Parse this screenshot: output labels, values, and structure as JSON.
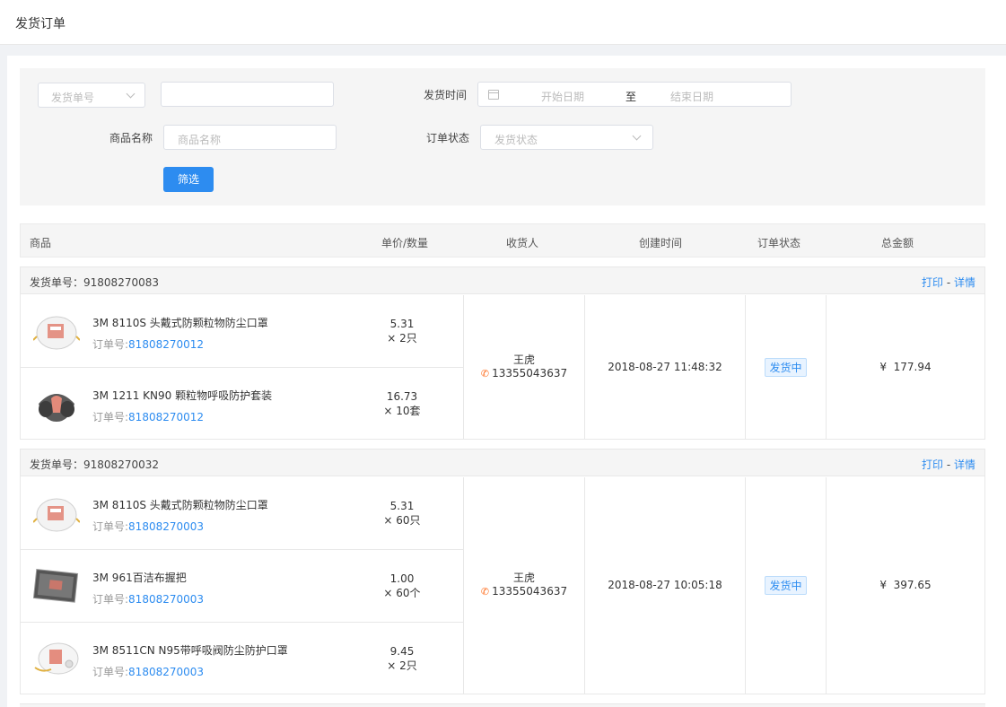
{
  "page": {
    "title": "发货订单"
  },
  "filter": {
    "field_select_placeholder": "发货单号",
    "keyword_value": "",
    "time_label": "发货时间",
    "date_start_placeholder": "开始日期",
    "date_separator": "至",
    "date_end_placeholder": "结束日期",
    "product_label": "商品名称",
    "product_placeholder": "商品名称",
    "status_label": "订单状态",
    "status_placeholder": "发货状态",
    "submit_label": "筛选"
  },
  "table": {
    "headers": [
      "商品",
      "单价/数量",
      "收货人",
      "创建时间",
      "订单状态",
      "总金额"
    ]
  },
  "labels": {
    "shipment_no_prefix": "发货单号：",
    "order_no_prefix": "订单号:",
    "print": "打印",
    "sep": "-",
    "detail": "详情",
    "currency": "¥"
  },
  "shipments": [
    {
      "shipment_no": "91808270083",
      "receiver": "王虎",
      "phone": "13355043637",
      "created": "2018-08-27 11:48:32",
      "status": "发货中",
      "total": "177.94",
      "items": [
        {
          "name": "3M 8110S 头戴式防颗粒物防尘口罩",
          "order_no": "81808270012",
          "price": "5.31",
          "qty": "× 2只",
          "thumb": "mask-white"
        },
        {
          "name": "3M 1211 KN90 颗粒物呼吸防护套装",
          "order_no": "81808270012",
          "price": "16.73",
          "qty": "× 10套",
          "thumb": "respirator-gray"
        }
      ]
    },
    {
      "shipment_no": "91808270032",
      "receiver": "王虎",
      "phone": "13355043637",
      "created": "2018-08-27 10:05:18",
      "status": "发货中",
      "total": "397.65",
      "items": [
        {
          "name": "3M 8110S 头戴式防颗粒物防尘口罩",
          "order_no": "81808270003",
          "price": "5.31",
          "qty": "× 60只",
          "thumb": "mask-white"
        },
        {
          "name": "3M 961百洁布握把",
          "order_no": "81808270003",
          "price": "1.00",
          "qty": "× 60个",
          "thumb": "scrub-pad"
        },
        {
          "name": "3M 8511CN N95带呼吸阀防尘防护口罩",
          "order_no": "81808270003",
          "price": "9.45",
          "qty": "× 2只",
          "thumb": "mask-valve"
        }
      ]
    }
  ]
}
